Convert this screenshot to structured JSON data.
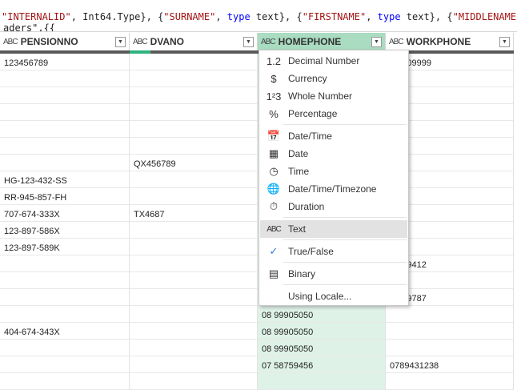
{
  "formula": {
    "prefix": "aders\",{{",
    "parts": [
      {
        "t": "\"INTERNALID\"",
        "c": "s"
      },
      {
        "t": ", Int64.Type}, {",
        "c": ""
      },
      {
        "t": "\"SURNAME\"",
        "c": "s"
      },
      {
        "t": ", ",
        "c": ""
      },
      {
        "t": "type",
        "c": "k"
      },
      {
        "t": " text}, {",
        "c": ""
      },
      {
        "t": "\"FIRSTNAME\"",
        "c": "s"
      },
      {
        "t": ", ",
        "c": ""
      },
      {
        "t": "type",
        "c": "k"
      },
      {
        "t": " text}, {",
        "c": ""
      },
      {
        "t": "\"MIDDLENAME",
        "c": "s"
      }
    ]
  },
  "type_icon_text": "ABC",
  "dropdown_icon": "▼",
  "columns": [
    {
      "name": "PENSIONNO",
      "cells": [
        "123456789",
        "",
        "",
        "",
        "",
        "",
        "",
        "HG-123-432-SS",
        "RR-945-857-FH",
        "707-674-333X",
        "123-897-586X",
        "123-897-589K",
        "",
        "",
        "",
        "",
        "404-674-343X",
        "",
        "",
        ""
      ]
    },
    {
      "name": "DVANO",
      "cells": [
        "",
        "",
        "",
        "",
        "",
        "",
        "QX456789",
        "",
        "",
        "TX4687",
        "",
        "",
        "",
        "",
        "",
        "",
        "",
        "",
        "",
        ""
      ]
    },
    {
      "name": "HOMEPHONE",
      "cells": [
        "",
        "",
        "",
        "",
        "",
        "",
        "",
        "",
        "",
        "",
        "",
        "",
        "",
        "",
        "",
        "08 99905050",
        "08 99905050",
        "08 99905050",
        "07 58759456",
        ""
      ]
    },
    {
      "name": "WORKPHONE",
      "cells": [
        "...0509999",
        "",
        "",
        "",
        "",
        "",
        "",
        "",
        "",
        "",
        "",
        "",
        "...679412",
        "",
        "...999787",
        "",
        "",
        "",
        "0789431238",
        ""
      ]
    }
  ],
  "menu": {
    "items": [
      {
        "label": "Decimal Number",
        "icon": "1.2"
      },
      {
        "label": "Currency",
        "icon": "$"
      },
      {
        "label": "Whole Number",
        "icon": "1²3"
      },
      {
        "label": "Percentage",
        "icon": "%"
      },
      {
        "label": "Date/Time",
        "icon": "📅"
      },
      {
        "label": "Date",
        "icon": "▦"
      },
      {
        "label": "Time",
        "icon": "◷"
      },
      {
        "label": "Date/Time/Timezone",
        "icon": "🌐"
      },
      {
        "label": "Duration",
        "icon": "⏱"
      },
      {
        "label": "Text",
        "icon": "ABC"
      },
      {
        "label": "True/False",
        "icon": "✓"
      },
      {
        "label": "Binary",
        "icon": "▤"
      },
      {
        "label": "Using Locale...",
        "icon": ""
      }
    ]
  }
}
